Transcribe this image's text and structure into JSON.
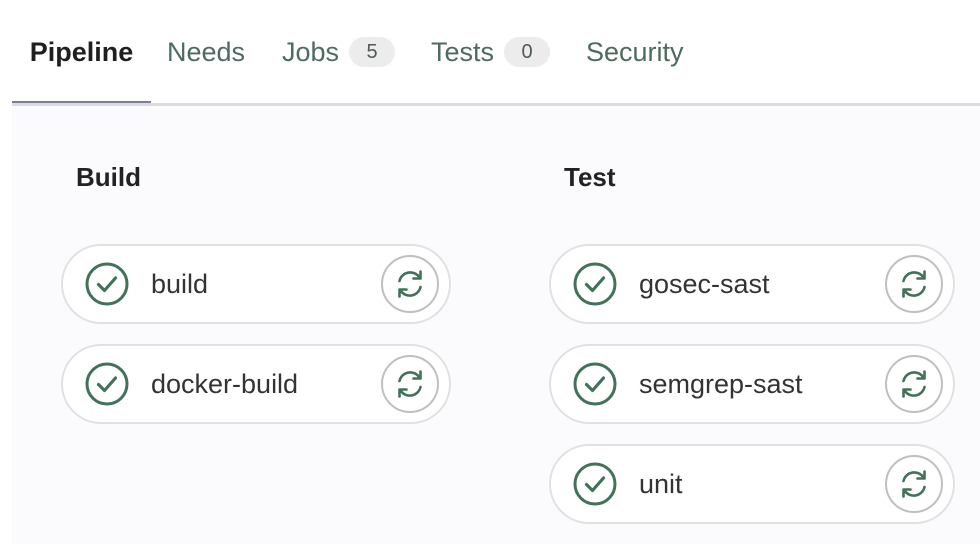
{
  "tabs": {
    "pipeline": {
      "label": "Pipeline",
      "active": true
    },
    "needs": {
      "label": "Needs"
    },
    "jobs": {
      "label": "Jobs",
      "count": "5"
    },
    "tests": {
      "label": "Tests",
      "count": "0"
    },
    "security": {
      "label": "Security"
    }
  },
  "stages": [
    {
      "title": "Build",
      "jobs": [
        {
          "name": "build",
          "status": "success",
          "status_icon": "check-circle-icon",
          "action_icon": "retry-icon"
        },
        {
          "name": "docker-build",
          "status": "success",
          "status_icon": "check-circle-icon",
          "action_icon": "retry-icon"
        }
      ]
    },
    {
      "title": "Test",
      "jobs": [
        {
          "name": "gosec-sast",
          "status": "success",
          "status_icon": "check-circle-icon",
          "action_icon": "retry-icon"
        },
        {
          "name": "semgrep-sast",
          "status": "success",
          "status_icon": "check-circle-icon",
          "action_icon": "retry-icon"
        },
        {
          "name": "unit",
          "status": "success",
          "status_icon": "check-circle-icon",
          "action_icon": "retry-icon"
        }
      ]
    }
  ],
  "colors": {
    "success": "#44715a",
    "active_tab_underline": "#7a7e9c",
    "inactive_tab_text": "#4f6a5e",
    "retry_icon": "#44715a"
  }
}
